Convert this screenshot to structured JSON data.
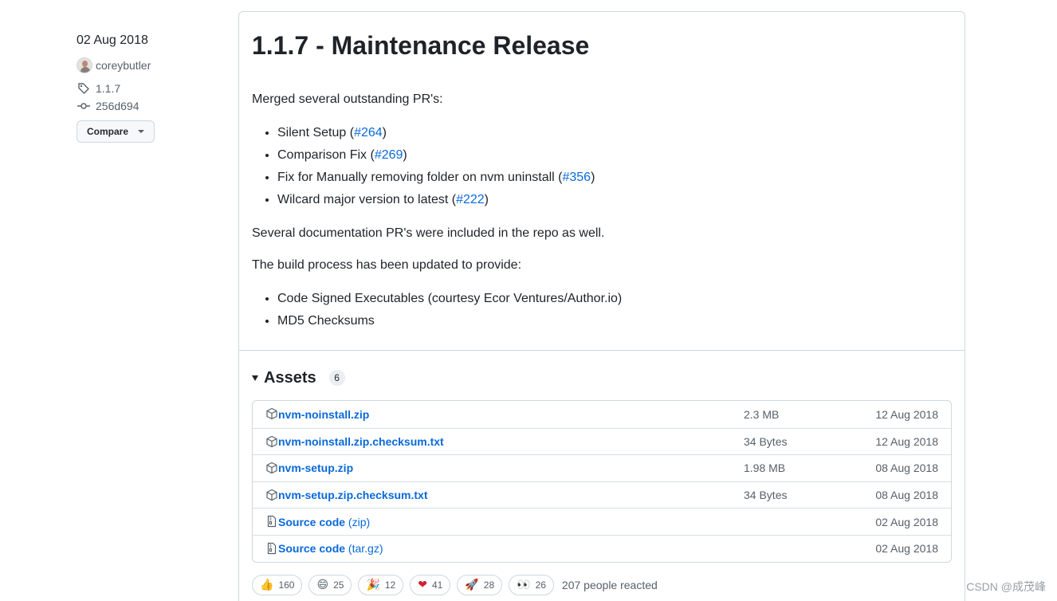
{
  "meta": {
    "date": "02 Aug 2018",
    "author": "coreybutler",
    "tag": "1.1.7",
    "commit": "256d694",
    "compare_label": "Compare"
  },
  "release": {
    "title": "1.1.7 - Maintenance Release",
    "intro": "Merged several outstanding PR's:",
    "prs": [
      {
        "text": "Silent Setup",
        "ref": "#264"
      },
      {
        "text": "Comparison Fix",
        "ref": "#269"
      },
      {
        "text": "Fix for Manually removing folder on nvm uninstall",
        "ref": "#356"
      },
      {
        "text": "Wilcard major version to latest",
        "ref": "#222"
      }
    ],
    "docs_note": "Several documentation PR's were included in the repo as well.",
    "build_intro": "The build process has been updated to provide:",
    "build_items": [
      "Code Signed Executables (courtesy Ecor Ventures/Author.io)",
      "MD5 Checksums"
    ]
  },
  "assets": {
    "label": "Assets",
    "count": "6",
    "items": [
      {
        "icon": "package-icon",
        "name": "nvm-noinstall.zip",
        "ext": "",
        "size": "2.3 MB",
        "date": "12 Aug 2018"
      },
      {
        "icon": "package-icon",
        "name": "nvm-noinstall.zip.checksum.txt",
        "ext": "",
        "size": "34 Bytes",
        "date": "12 Aug 2018"
      },
      {
        "icon": "package-icon",
        "name": "nvm-setup.zip",
        "ext": "",
        "size": "1.98 MB",
        "date": "08 Aug 2018"
      },
      {
        "icon": "package-icon",
        "name": "nvm-setup.zip.checksum.txt",
        "ext": "",
        "size": "34 Bytes",
        "date": "08 Aug 2018"
      },
      {
        "icon": "file-zip-icon",
        "name": "Source code",
        "ext": "(zip)",
        "size": "",
        "date": "02 Aug 2018"
      },
      {
        "icon": "file-zip-icon",
        "name": "Source code",
        "ext": "(tar.gz)",
        "size": "",
        "date": "02 Aug 2018"
      }
    ]
  },
  "reactions": {
    "items": [
      {
        "name": "thumbs-up",
        "emoji": "👍",
        "count": "160"
      },
      {
        "name": "laugh",
        "emoji": "😄",
        "count": "25"
      },
      {
        "name": "hooray",
        "emoji": "🎉",
        "count": "12"
      },
      {
        "name": "heart",
        "emoji": "❤",
        "count": "41"
      },
      {
        "name": "rocket",
        "emoji": "🚀",
        "count": "28"
      },
      {
        "name": "eyes",
        "emoji": "👀",
        "count": "26"
      }
    ],
    "summary": "207 people reacted"
  },
  "watermark": "CSDN @成茂峰"
}
